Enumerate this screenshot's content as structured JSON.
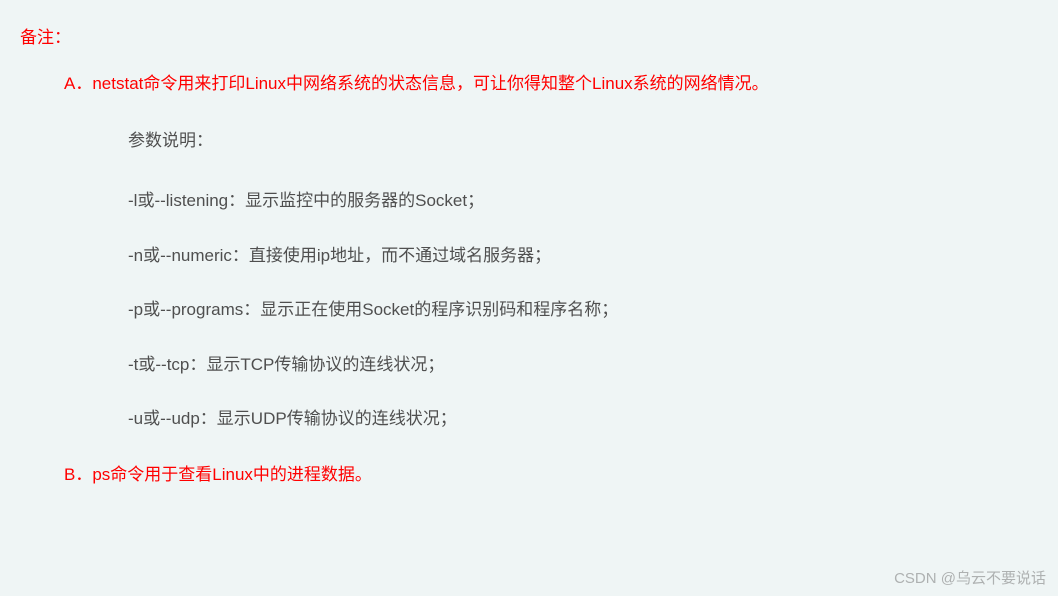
{
  "note_label": "备注：",
  "section_a": "A．netstat命令用来打印Linux中网络系统的状态信息，可让你得知整个Linux系统的网络情况。",
  "params_title": "参数说明：",
  "params": [
    "-l或--listening：显示监控中的服务器的Socket；",
    "-n或--numeric：直接使用ip地址，而不通过域名服务器；",
    "-p或--programs：显示正在使用Socket的程序识别码和程序名称；",
    "-t或--tcp：显示TCP传输协议的连线状况；",
    "-u或--udp：显示UDP传输协议的连线状况；"
  ],
  "section_b": "B．ps命令用于查看Linux中的进程数据。",
  "watermark": "CSDN @乌云不要说话"
}
